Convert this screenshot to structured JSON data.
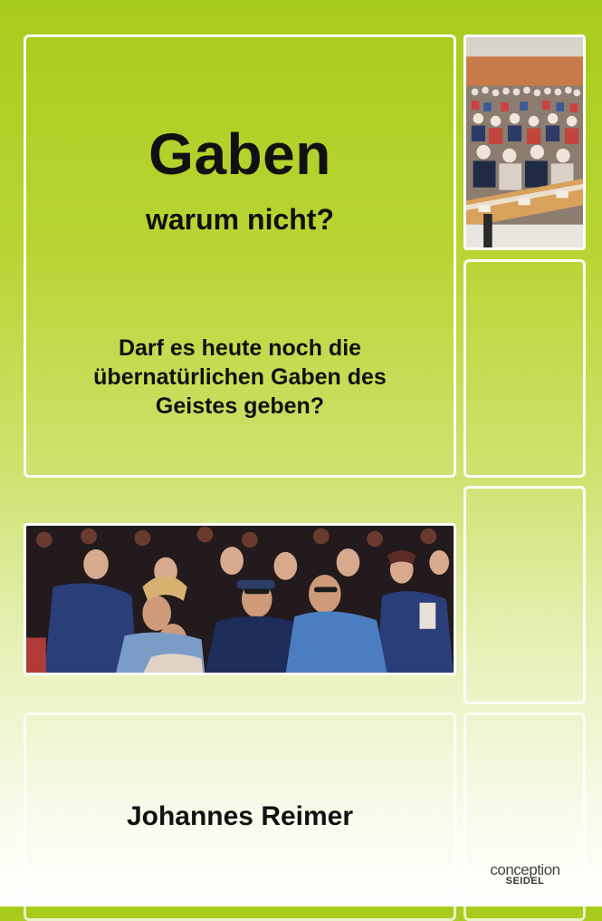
{
  "cover": {
    "title": "Gaben",
    "subtitle": "warum nicht?",
    "tagline_lines": [
      "Darf es heute noch die",
      "übernatürlichen Gaben des",
      "Geistes geben?"
    ],
    "author": "Johannes Reimer",
    "publisher_logo": [
      "conception",
      "SEIDEL"
    ],
    "colors": {
      "background_top": "#a8cc1c",
      "background_bottom": "#ffffff",
      "frame": "#ffffff",
      "text": "#111111"
    }
  },
  "images": {
    "top_right_photo": "conference-hall-audience-photo",
    "middle_photo": "crowd-looking-up-photo"
  }
}
